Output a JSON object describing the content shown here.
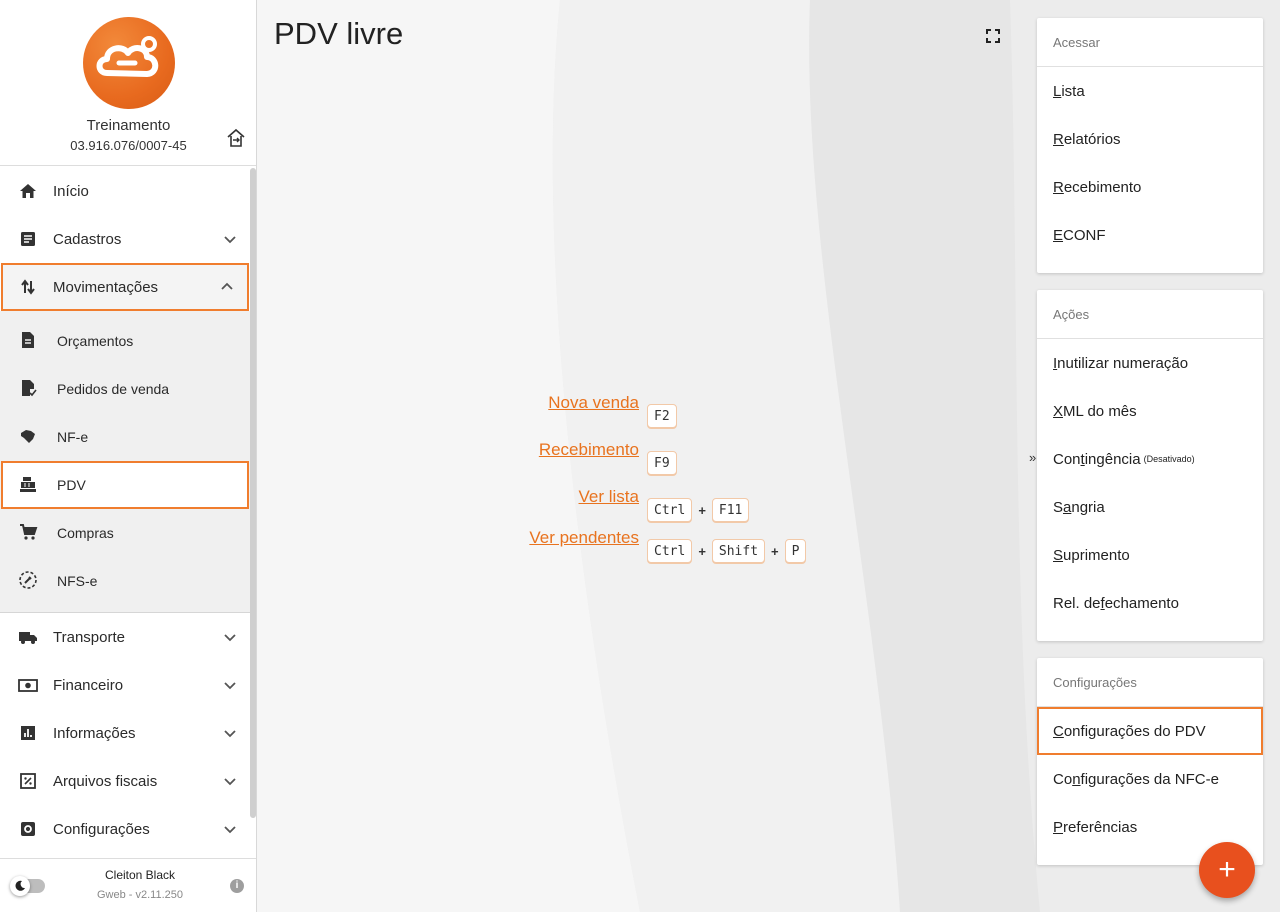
{
  "company": {
    "name": "Treinamento",
    "document": "03.916.076/0007-45"
  },
  "nav": {
    "items_top": [
      {
        "label": "Início"
      },
      {
        "label": "Cadastros"
      },
      {
        "label": "Movimentações"
      }
    ],
    "sub_items": [
      {
        "label": "Orçamentos"
      },
      {
        "label": "Pedidos de venda"
      },
      {
        "label": "NF-e"
      },
      {
        "label": "PDV"
      },
      {
        "label": "Compras"
      },
      {
        "label": "NFS-e"
      }
    ],
    "items_bottom": [
      {
        "label": "Transporte"
      },
      {
        "label": "Financeiro"
      },
      {
        "label": "Informações"
      },
      {
        "label": "Arquivos fiscais"
      },
      {
        "label": "Configurações"
      }
    ]
  },
  "footer": {
    "user_name": "Cleiton Black",
    "app_version": "Gweb - v2.11.250"
  },
  "main": {
    "title": "PDV livre",
    "shortcuts": [
      {
        "label": "Nova venda",
        "keys": [
          "F2"
        ]
      },
      {
        "label": "Recebimento",
        "keys": [
          "F9"
        ]
      },
      {
        "label": "Ver lista",
        "keys": [
          "Ctrl",
          "F11"
        ]
      },
      {
        "label": "Ver pendentes",
        "keys": [
          "Ctrl",
          "Shift",
          "P"
        ]
      }
    ],
    "plus_sign": "+"
  },
  "panels": {
    "acessar": {
      "title": "Acessar",
      "items": [
        {
          "first": "L",
          "rest": "ista"
        },
        {
          "first": "R",
          "rest": "elatórios"
        },
        {
          "first": "R",
          "rest": "ecebimento"
        },
        {
          "first": "E",
          "rest": "CONF"
        }
      ]
    },
    "acoes": {
      "title": "Ações",
      "items": [
        {
          "pre": "",
          "u": "I",
          "post": "nutilizar numeração",
          "note": ""
        },
        {
          "pre": "",
          "u": "X",
          "post": "ML do mês",
          "note": ""
        },
        {
          "pre": "Con",
          "u": "t",
          "post": "ingência",
          "note": "(Desativado)"
        },
        {
          "pre": "S",
          "u": "a",
          "post": "ngria",
          "note": ""
        },
        {
          "pre": "",
          "u": "S",
          "post": "uprimento",
          "note": ""
        },
        {
          "pre": "Rel. de ",
          "u": "f",
          "post": "echamento",
          "note": ""
        }
      ]
    },
    "configuracoes": {
      "title": "Configurações",
      "items": [
        {
          "pre": "",
          "u": "C",
          "post": "onfigurações do PDV"
        },
        {
          "pre": "Co",
          "u": "n",
          "post": "figurações da NFC-e"
        },
        {
          "pre": "",
          "u": "P",
          "post": "referências"
        }
      ]
    }
  },
  "collapse_glyph": "»",
  "fab_label": "+",
  "colors": {
    "accent": "#f07d2e",
    "link": "#e8731f",
    "fab": "#e8501e"
  }
}
